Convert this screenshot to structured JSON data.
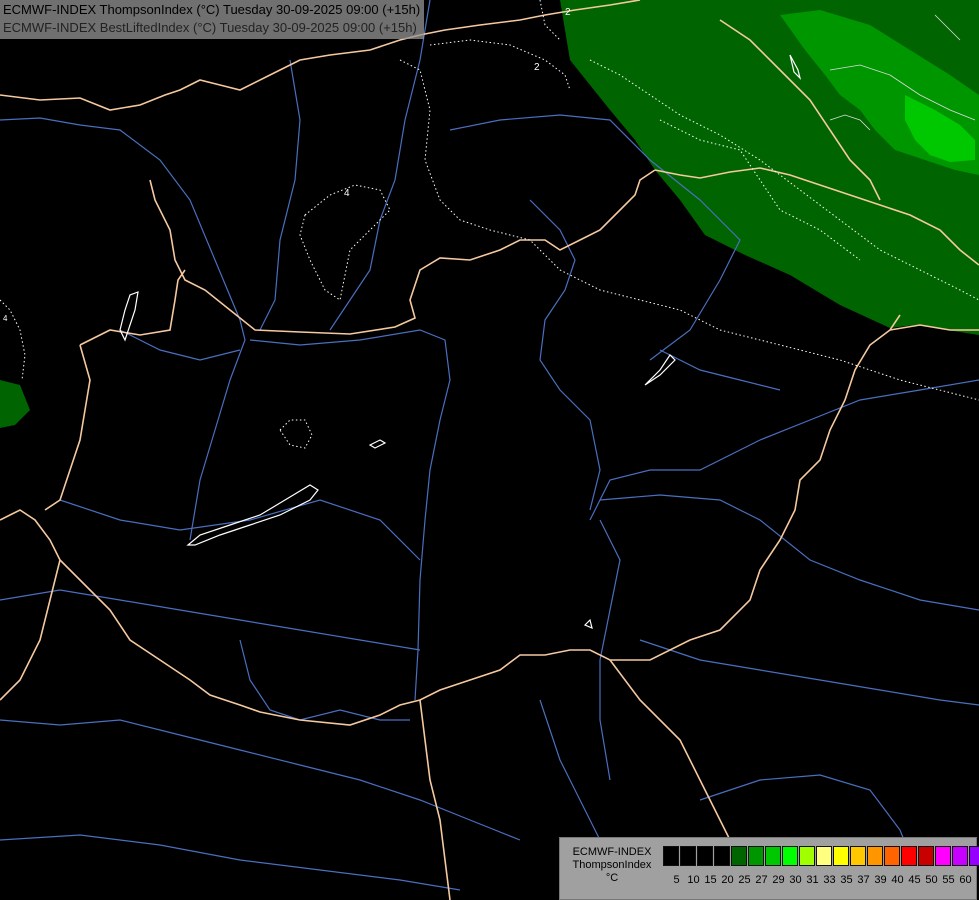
{
  "title": {
    "line1": "ECMWF-INDEX ThompsonIndex (°C) Tuesday 30-09-2025 09:00 (+15h)",
    "line2": "ECMWF-INDEX BestLiftedIndex (°C) Tuesday 30-09-2025 09:00 (+15h)"
  },
  "contour_labels": [
    "2",
    "2",
    "4",
    "4"
  ],
  "legend": {
    "line1": "ECMWF-INDEX",
    "line2": "ThompsonIndex",
    "line3": "°C",
    "colors": [
      "#000000",
      "#000000",
      "#000000",
      "#000000",
      "#006400",
      "#009600",
      "#00c800",
      "#00ff00",
      "#a0ff00",
      "#ffff80",
      "#ffff00",
      "#ffc800",
      "#ff9600",
      "#ff6400",
      "#ff0000",
      "#c80000",
      "#ff00ff",
      "#c800ff",
      "#9600ff",
      "#6400ff",
      "#0000ff"
    ],
    "ticks": [
      "5",
      "10",
      "15",
      "20",
      "25",
      "27",
      "29",
      "30",
      "31",
      "33",
      "35",
      "37",
      "39",
      "40",
      "45",
      "50",
      "55",
      "60"
    ]
  },
  "colors": {
    "background": "#000000",
    "border": "#f5c9a0",
    "river": "#4a6fbf",
    "index_low": "#006400",
    "index_mid": "#009600",
    "index_high": "#00c800",
    "lake": "#ffffff"
  }
}
